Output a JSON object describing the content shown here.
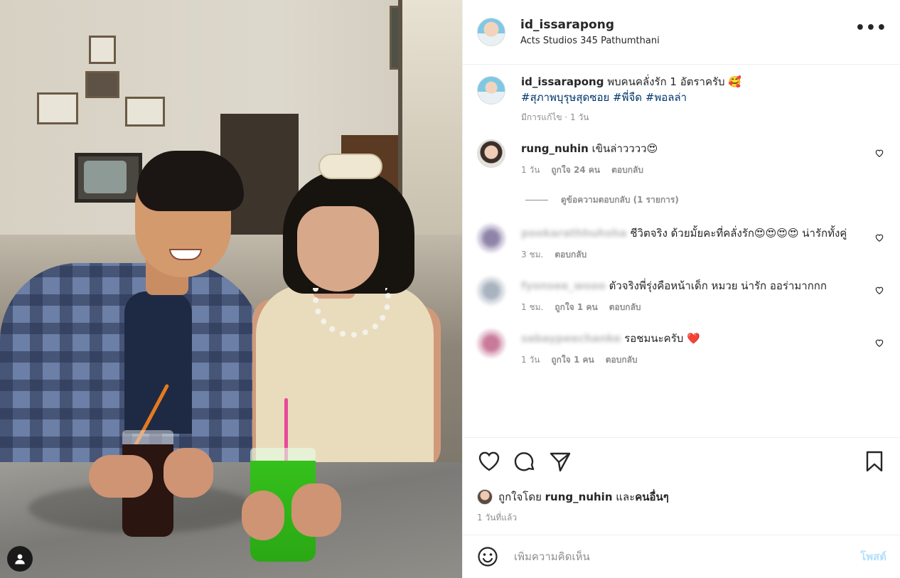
{
  "post": {
    "author": "id_issarapong",
    "location": "Acts Studios 345 Pathumthani",
    "more_label": "•••"
  },
  "caption": {
    "author": "id_issarapong",
    "text": "พบคนคลั่งรัก 1 อัตราครับ 🥰",
    "hashtags": [
      "#สุภาพบุรุษสุดซอย",
      "#พี่จืด",
      "#พอลล่า"
    ],
    "meta": "มีการแก้ไข · 1 วัน"
  },
  "comments": [
    {
      "author": "rung_nuhin",
      "text": "เขินล่าวววว😍",
      "time": "1 วัน",
      "likes": "ถูกใจ 24 คน",
      "reply": "ตอบกลับ",
      "view_replies": "ดูข้อความตอบกลับ (1 รายการ)"
    },
    {
      "author": "pookarathhuhsha",
      "text": "ชีวิตจริง ด้วยมั้ยคะที่คลั่งรัก😍😍😍😍 น่ารักทั้งคู่",
      "time": "3 ชม.",
      "reply": "ตอบกลับ"
    },
    {
      "author": "fyonsee_wooo",
      "text": "ตัวจริงพี่รุ่งคือหน้าเด็ก หมวย น่ารัก ออร่ามากกก",
      "time": "1 ชม.",
      "likes": "ถูกใจ 1 คน",
      "reply": "ตอบกลับ"
    },
    {
      "author": "sabaypeechanke",
      "text": "รอชมนะครับ ❤️",
      "time": "1 วัน",
      "likes": "ถูกใจ 1 คน",
      "reply": "ตอบกลับ"
    }
  ],
  "likes": {
    "prefix": "ถูกใจโดย",
    "user": "rung_nuhin",
    "joiner": "และ",
    "others": "คนอื่นๆ"
  },
  "post_time": "1 วันที่แล้ว",
  "composer": {
    "placeholder": "เพิ่มความคิดเห็น",
    "post_label": "โพสต์"
  },
  "colors": {
    "hashtag": "#00376b",
    "meta": "#8e8e8e",
    "post_button": "#b2dffc"
  }
}
